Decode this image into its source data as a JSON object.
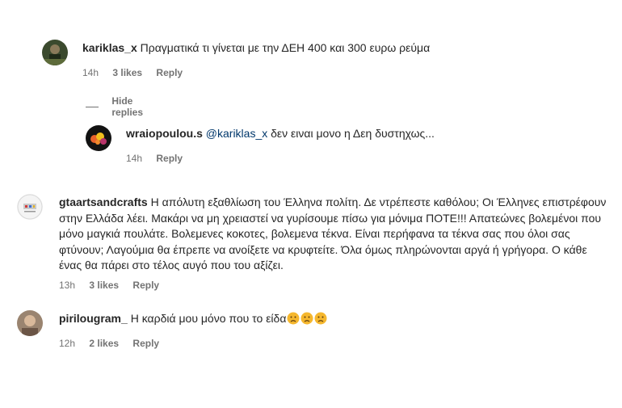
{
  "comments": [
    {
      "username": "kariklas_x",
      "text": "Πραγματικά τι γίνεται με την ΔΕΗ 400 και 300 ευρω ρεύμα",
      "time": "14h",
      "likes": "3 likes",
      "reply": "Reply",
      "hide_replies": "Hide replies",
      "replies": [
        {
          "username": "wraiopoulou.s",
          "mention": "@kariklas_x",
          "text": "δεν ειναι μονο η Δεη δυστηχως...",
          "time": "14h",
          "reply": "Reply"
        }
      ]
    },
    {
      "username": "gtaartsandcrafts",
      "text": "Η απόλυτη εξαθλίωση του Έλληνα πολίτη. Δε ντρέπεστε καθόλου; Οι Έλληνες επιστρέφουν στην Ελλάδα λέει. Μακάρι να μη χρειαστεί να γυρίσουμε πίσω για μόνιμα ΠΟΤΕ!!! Απατεώνες βολεμένοι που μόνο μαγκιά πουλάτε. Βολεμενες κοκοτες, βολεμενα τέκνα. Είναι περήφανα τα τέκνα σας που όλοι σας φτύνουν; Λαγούμια θα έπρεπε να ανοίξετε να κρυφτείτε. Όλα όμως πληρώνονται αργά ή γρήγορα. Ο κάθε ένας θα πάρει στο τέλος αυγό που του αξίζει.",
      "time": "13h",
      "likes": "3 likes",
      "reply": "Reply"
    },
    {
      "username": "pirilougram_",
      "text": "Η καρδιά μου μόνο που το είδα",
      "emojis": [
        "sad-face-emoji",
        "sad-face-emoji",
        "sad-face-emoji"
      ],
      "time": "12h",
      "likes": "2 likes",
      "reply": "Reply"
    }
  ]
}
